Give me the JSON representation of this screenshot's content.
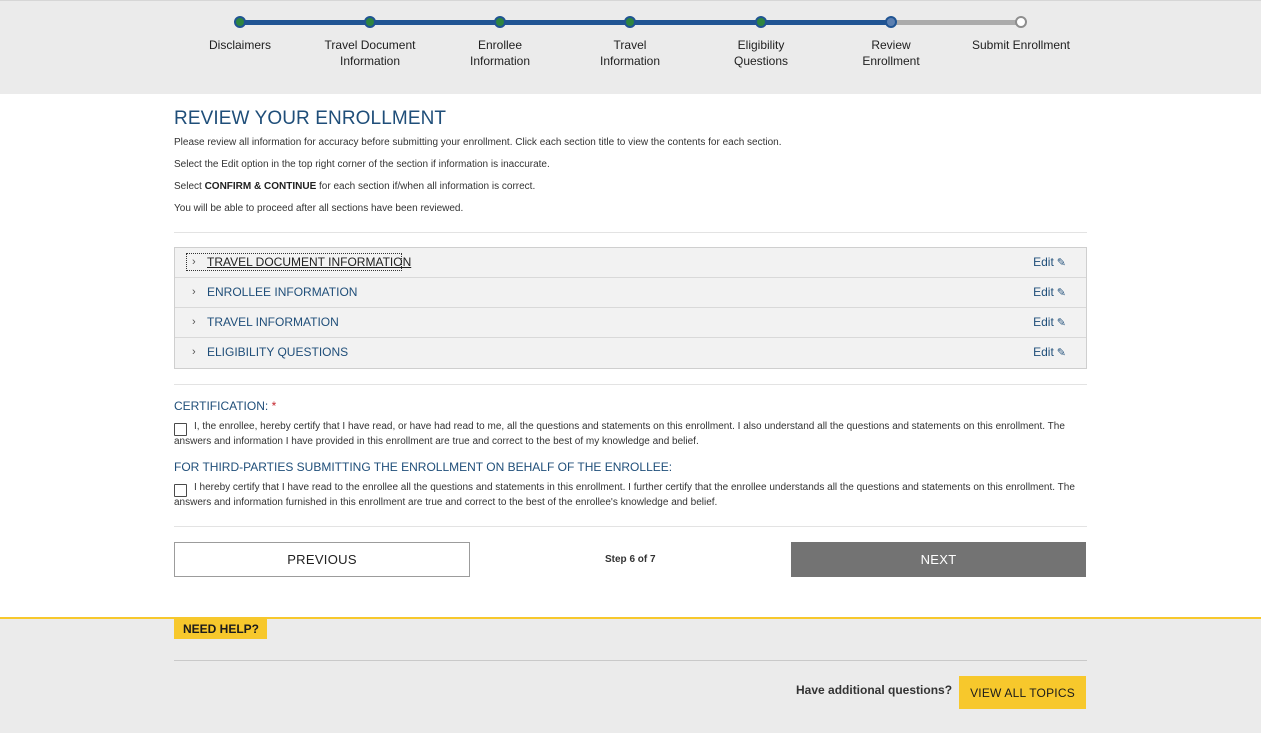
{
  "progress": {
    "steps": [
      {
        "label": "Disclaimers",
        "state": "complete"
      },
      {
        "label": "Travel Document\nInformation",
        "state": "complete"
      },
      {
        "label": "Enrollee\nInformation",
        "state": "complete"
      },
      {
        "label": "Travel\nInformation",
        "state": "complete"
      },
      {
        "label": "Eligibility\nQuestions",
        "state": "complete"
      },
      {
        "label": "Review\nEnrollment",
        "state": "current"
      },
      {
        "label": "Submit Enrollment",
        "state": "pending"
      }
    ]
  },
  "page": {
    "title": "REVIEW YOUR ENROLLMENT",
    "intro_1": "Please review all information for accuracy before submitting your enrollment. Click each section title to view the contents for each section.",
    "intro_2": "Select the Edit option in the top right corner of the section if information is inaccurate.",
    "intro_3_prefix": "Select ",
    "intro_3_strong": "CONFIRM & CONTINUE",
    "intro_3_suffix": " for each section if/when all information is correct.",
    "intro_4": "You will be able to proceed after all sections have been reviewed."
  },
  "sections": {
    "edit_label": "Edit",
    "items": [
      {
        "title": "TRAVEL DOCUMENT INFORMATION"
      },
      {
        "title": "ENROLLEE INFORMATION"
      },
      {
        "title": "TRAVEL INFORMATION"
      },
      {
        "title": "ELIGIBILITY QUESTIONS"
      }
    ]
  },
  "certification": {
    "heading": "CERTIFICATION:",
    "required_mark": "*",
    "text": "I, the enrollee, hereby certify that I have read, or have had read to me, all the questions and statements on this enrollment. I also understand all the questions and statements on this enrollment. The answers and information I have provided in this enrollment are true and correct to the best of my knowledge and belief.",
    "checked": false
  },
  "third_party": {
    "heading": "FOR THIRD-PARTIES SUBMITTING THE ENROLLMENT ON BEHALF OF THE ENROLLEE:",
    "text": "I hereby certify that I have read to the enrollee all the questions and statements in this enrollment. I further certify that the enrollee understands all the questions and statements on this enrollment. The answers and information furnished in this enrollment are true and correct to the best of the enrollee's knowledge and belief.",
    "checked": false
  },
  "navigation": {
    "previous_label": "PREVIOUS",
    "step_text": "Step 6 of 7",
    "next_label": "NEXT"
  },
  "help": {
    "tag": "NEED HELP?",
    "question": "Have additional questions?",
    "button_label": "VIEW ALL TOPICS"
  },
  "colors": {
    "accent_blue": "#205493",
    "heading_blue": "#1f4e79",
    "complete_green": "#2e8540",
    "help_yellow": "#f7c82c",
    "next_button_gray": "#737373"
  }
}
